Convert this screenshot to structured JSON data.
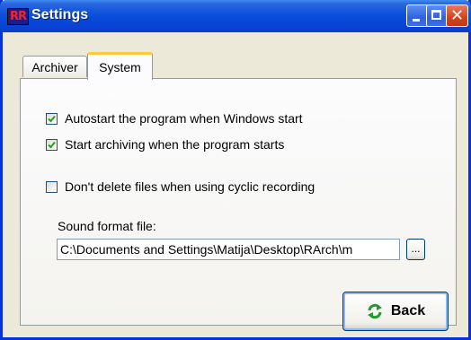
{
  "window": {
    "title": "Settings",
    "icon_text": "RR",
    "controls": {
      "minimize": "minimize-icon",
      "maximize": "maximize-icon",
      "close": "close-icon"
    }
  },
  "tabs": [
    {
      "label": "Archiver",
      "selected": false
    },
    {
      "label": "System",
      "selected": true
    }
  ],
  "options": [
    {
      "label": "Autostart the program when Windows start",
      "checked": true
    },
    {
      "label": "Start archiving when the program starts",
      "checked": true
    },
    {
      "label": "Don't delete files when using cyclic recording",
      "checked": false
    }
  ],
  "sound_format": {
    "label": "Sound format file:",
    "value": "C:\\Documents and Settings\\Matija\\Desktop\\RArch\\m",
    "browse_label": "..."
  },
  "back_button": {
    "label": "Back",
    "icon": "refresh-icon"
  },
  "colors": {
    "titlebar": "#0a50dc",
    "accent_tab": "#ffc83c",
    "check": "#21a121",
    "back_icon": "#1f9a2e"
  }
}
